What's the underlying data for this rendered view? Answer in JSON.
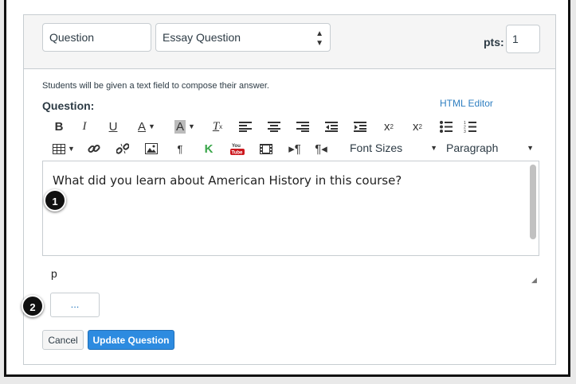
{
  "header": {
    "question_name": "Question",
    "question_type": "Essay Question",
    "pts_label": "pts:",
    "pts_value": "1"
  },
  "body": {
    "hint": "Students will be given a text field to compose their answer.",
    "question_label": "Question:",
    "html_editor_link": "HTML Editor"
  },
  "toolbar": {
    "row1": [
      "bold-icon",
      "italic-icon",
      "underline-icon",
      "text-color-icon",
      "background-color-icon",
      "clear-formatting-icon",
      "align-left-icon",
      "align-center-icon",
      "align-right-icon",
      "outdent-icon",
      "indent-icon",
      "superscript-icon",
      "subscript-icon",
      "bullet-list-icon",
      "numbered-list-icon"
    ],
    "row2": [
      "table-icon",
      "link-icon",
      "unlink-icon",
      "image-icon",
      "pilcrow-icon",
      "kaltura-icon",
      "youtube-icon",
      "media-icon",
      "ltr-icon",
      "rtl-icon"
    ],
    "font_sizes_label": "Font Sizes",
    "paragraph_label": "Paragraph"
  },
  "editor": {
    "content": "What did you learn about American History in this course?",
    "path": "p",
    "callout": "..."
  },
  "buttons": {
    "cancel": "Cancel",
    "update": "Update Question"
  },
  "badges": [
    "1",
    "2"
  ],
  "colors": {
    "accent": "#2d8be0",
    "link": "#2f7fc1",
    "header_bg": "#f5f5f5"
  }
}
